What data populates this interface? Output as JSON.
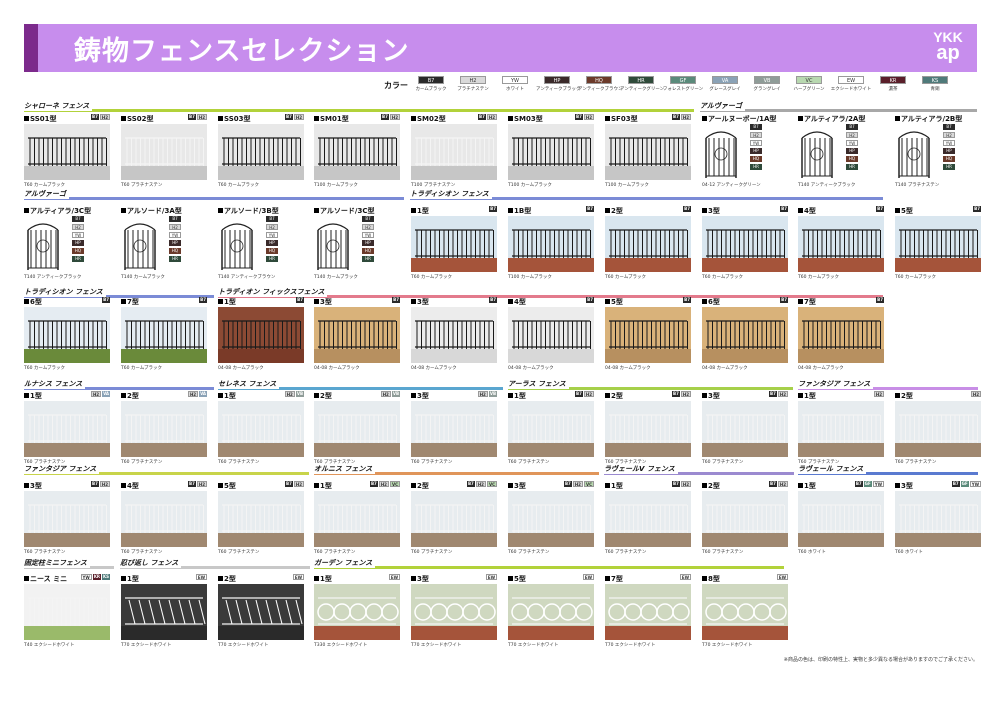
{
  "header": {
    "title": "鋳物フェンスセレクション",
    "logo_line1": "YKK",
    "logo_line2": "ap"
  },
  "colors": {
    "label": "カラー",
    "items": [
      {
        "code": "B7",
        "name": "カームブラック",
        "color": "#2a2a2a",
        "text": "#fff"
      },
      {
        "code": "H2",
        "name": "プラチナステン",
        "color": "#d9d9d9",
        "text": "#333"
      },
      {
        "code": "YW",
        "name": "ホワイト",
        "color": "#ffffff",
        "text": "#333"
      },
      {
        "code": "HP",
        "name": "アンティークブラック",
        "color": "#3a2a2a",
        "text": "#fff"
      },
      {
        "code": "HQ",
        "name": "アンティークブラウン",
        "color": "#6b3a2a",
        "text": "#fff"
      },
      {
        "code": "HR",
        "name": "アンティークグリーン",
        "color": "#2f4a3a",
        "text": "#fff"
      },
      {
        "code": "GF",
        "name": "フォレストグリーン",
        "color": "#5a8a7a",
        "text": "#fff"
      },
      {
        "code": "VA",
        "name": "グレースグレイ",
        "color": "#8aa2b6",
        "text": "#fff"
      },
      {
        "code": "VB",
        "name": "グラングレイ",
        "color": "#8f9c98",
        "text": "#fff"
      },
      {
        "code": "VC",
        "name": "ハーブグリーン",
        "color": "#b8d8b0",
        "text": "#333"
      },
      {
        "code": "EW",
        "name": "エクシードホワイト",
        "color": "#ffffff",
        "text": "#333"
      },
      {
        "code": "KR",
        "name": "濃茶",
        "color": "#5a1f2a",
        "text": "#fff"
      },
      {
        "code": "KS",
        "name": "青銅",
        "color": "#4f7a7a",
        "text": "#fff"
      }
    ]
  },
  "sections": [
    {
      "id": "s1",
      "title": "シャローネ フェンス",
      "stripe": "#b2d23a"
    },
    {
      "id": "s2",
      "title": "アルヴァーゴ",
      "stripe": "#a8a8a8"
    },
    {
      "id": "s3",
      "title": "アルヴァーゴ",
      "stripe": "#7b8bd6"
    },
    {
      "id": "s4",
      "title": "トラディシオン フェンス",
      "stripe": "#7b8bd6"
    },
    {
      "id": "s5",
      "title": "トラディシオン フェンス",
      "stripe": "#7b8bd6"
    },
    {
      "id": "s6",
      "title": "トラディオン フィックスフェンス",
      "stripe": "#e37a8c"
    },
    {
      "id": "s7",
      "title": "ルナシス フェンス",
      "stripe": "#7b8bd6"
    },
    {
      "id": "s8",
      "title": "セレネス フェンス",
      "stripe": "#5aa6d0"
    },
    {
      "id": "s9",
      "title": "アーラス フェンス",
      "stripe": "#a6d04a"
    },
    {
      "id": "s10",
      "title": "ファンタジア フェンス",
      "stripe": "#c88ee6"
    },
    {
      "id": "s11",
      "title": "ファンタジア フェンス",
      "stripe": "#c8d44a"
    },
    {
      "id": "s12",
      "title": "オルニス フェンス",
      "stripe": "#e0955a"
    },
    {
      "id": "s13",
      "title": "ラヴェールV フェンス",
      "stripe": "#9b8ad0"
    },
    {
      "id": "s14",
      "title": "ラヴェール フェンス",
      "stripe": "#5a7ad0"
    },
    {
      "id": "s15",
      "title": "固定柱ミニフェンス",
      "stripe": "#c8c8c8"
    },
    {
      "id": "s16",
      "title": "忍び返し フェンス",
      "stripe": "#c8c8c8"
    },
    {
      "id": "s17",
      "title": "ガーデン フェンス",
      "stripe": "#b2d23a"
    }
  ],
  "cards": [
    {
      "name": "SS01型",
      "badges": [
        "B7",
        "H2"
      ],
      "caption": "T60 カームブラック"
    },
    {
      "name": "SS02型",
      "badges": [
        "B7",
        "H2"
      ],
      "caption": "T60 プラチナステン"
    },
    {
      "name": "SS03型",
      "badges": [
        "B7",
        "H2"
      ],
      "caption": "T60 カームブラック"
    },
    {
      "name": "SM01型",
      "badges": [
        "B7",
        "H2"
      ],
      "caption": "T100 カームブラック"
    },
    {
      "name": "SM02型",
      "badges": [
        "B7",
        "H2"
      ],
      "caption": "T100 プラチナステン"
    },
    {
      "name": "SM03型",
      "badges": [
        "B7",
        "H2"
      ],
      "caption": "T100 カームブラック"
    },
    {
      "name": "SF03型",
      "badges": [
        "B7",
        "H2"
      ],
      "caption": "T100 カームブラック"
    },
    {
      "name": "アールヌーボー/1A型",
      "badges": [
        "B7",
        "H2",
        "YW",
        "HP",
        "HQ",
        "HR"
      ],
      "caption": "04-12 アンティークグリーン"
    },
    {
      "name": "アルティアラ/2A型",
      "badges": [
        "B7",
        "H2",
        "YW",
        "HP",
        "HQ",
        "HR"
      ],
      "caption": "T140 アンティークブラック"
    },
    {
      "name": "アルティアラ/2B型",
      "badges": [
        "B7",
        "H2",
        "YW",
        "HP",
        "HQ",
        "HR"
      ],
      "caption": "T140 プラチナステン"
    },
    {
      "name": "アルティアラ/3C型",
      "badges": [
        "B7",
        "H2",
        "YW",
        "HP",
        "HQ",
        "HR"
      ],
      "caption": "T140 アンティークブラック"
    },
    {
      "name": "アルソード/3A型",
      "badges": [
        "B7",
        "H2",
        "YW",
        "HP",
        "HQ",
        "HR"
      ],
      "caption": "T140 カームブラック"
    },
    {
      "name": "アルソード/3B型",
      "badges": [
        "B7",
        "H2",
        "YW",
        "HP",
        "HQ",
        "HR"
      ],
      "caption": "T140 アンティークブラウン"
    },
    {
      "name": "アルソード/3C型",
      "badges": [
        "B7",
        "H2",
        "YW",
        "HP",
        "HQ",
        "HR"
      ],
      "caption": "T140 カームブラック"
    },
    {
      "name": "1型",
      "badges": [
        "B7"
      ],
      "caption": "T60 カームブラック"
    },
    {
      "name": "1B型",
      "badges": [
        "B7"
      ],
      "caption": "T100 カームブラック"
    },
    {
      "name": "2型",
      "badges": [
        "B7"
      ],
      "caption": "T60 カームブラック"
    },
    {
      "name": "3型",
      "badges": [
        "B7"
      ],
      "caption": "T60 カームブラック"
    },
    {
      "name": "4型",
      "badges": [
        "B7"
      ],
      "caption": "T60 カームブラック"
    },
    {
      "name": "5型",
      "badges": [
        "B7"
      ],
      "caption": "T60 カームブラック"
    },
    {
      "name": "6型",
      "badges": [
        "B7"
      ],
      "caption": "T60 カームブラック"
    },
    {
      "name": "7型",
      "badges": [
        "B7"
      ],
      "caption": "T60 カームブラック"
    },
    {
      "name": "1型",
      "badges": [
        "B7"
      ],
      "caption": "04-08 カームブラック"
    },
    {
      "name": "3型",
      "badges": [
        "B7"
      ],
      "caption": "04-08 カームブラック"
    },
    {
      "name": "3型",
      "badges": [
        "B7"
      ],
      "caption": "04-08 カームブラック"
    },
    {
      "name": "4型",
      "badges": [
        "B7"
      ],
      "caption": "04-08 カームブラック"
    },
    {
      "name": "5型",
      "badges": [
        "B7"
      ],
      "caption": "04-08 カームブラック"
    },
    {
      "name": "6型",
      "badges": [
        "B7"
      ],
      "caption": "04-08 カームブラック"
    },
    {
      "name": "7型",
      "badges": [
        "B7"
      ],
      "caption": "04-08 カームブラック"
    },
    {
      "name": "1型",
      "badges": [
        "H2",
        "VA"
      ],
      "caption": "T60 プラチナステン"
    },
    {
      "name": "2型",
      "badges": [
        "H2",
        "VA"
      ],
      "caption": "T60 プラチナステン"
    },
    {
      "name": "1型",
      "badges": [
        "H2",
        "VB"
      ],
      "caption": "T60 プラチナステン"
    },
    {
      "name": "2型",
      "badges": [
        "H2",
        "VB"
      ],
      "caption": "T60 プラチナステン"
    },
    {
      "name": "3型",
      "badges": [
        "H2",
        "VB"
      ],
      "caption": "T60 プラチナステン"
    },
    {
      "name": "1型",
      "badges": [
        "B7",
        "H2"
      ],
      "caption": "T60 プラチナステン"
    },
    {
      "name": "2型",
      "badges": [
        "B7",
        "H2"
      ],
      "caption": "T60 プラチナステン"
    },
    {
      "name": "3型",
      "badges": [
        "B7",
        "H2"
      ],
      "caption": "T60 プラチナステン"
    },
    {
      "name": "1型",
      "badges": [
        "H2"
      ],
      "caption": "T60 プラチナステン"
    },
    {
      "name": "2型",
      "badges": [
        "H2"
      ],
      "caption": "T60 プラチナステン"
    },
    {
      "name": "3型",
      "badges": [
        "B7",
        "H2"
      ],
      "caption": "T60 プラチナステン"
    },
    {
      "name": "4型",
      "badges": [
        "B7",
        "H2"
      ],
      "caption": "T60 プラチナステン"
    },
    {
      "name": "5型",
      "badges": [
        "B7",
        "H2"
      ],
      "caption": "T60 プラチナステン"
    },
    {
      "name": "1型",
      "badges": [
        "B7",
        "H2",
        "VC"
      ],
      "caption": "T60 プラチナステン"
    },
    {
      "name": "2型",
      "badges": [
        "B7",
        "H2",
        "VC"
      ],
      "caption": "T60 プラチナステン"
    },
    {
      "name": "3型",
      "badges": [
        "B7",
        "H2",
        "VC"
      ],
      "caption": "T60 プラチナステン"
    },
    {
      "name": "1型",
      "badges": [
        "B7",
        "H2"
      ],
      "caption": "T60 プラチナステン"
    },
    {
      "name": "2型",
      "badges": [
        "B7",
        "H2"
      ],
      "caption": "T60 プラチナステン"
    },
    {
      "name": "1型",
      "badges": [
        "B7",
        "GF",
        "YW"
      ],
      "caption": "T60 ホワイト"
    },
    {
      "name": "3型",
      "badges": [
        "B7",
        "GF",
        "YW"
      ],
      "caption": "T60 ホワイト"
    },
    {
      "name": "ニース ミニ",
      "badges": [
        "YW",
        "KR",
        "KS"
      ],
      "caption": "T40 エクシードホワイト"
    },
    {
      "name": "1型",
      "badges": [
        "EW"
      ],
      "caption": "T70 エクシードホワイト"
    },
    {
      "name": "2型",
      "badges": [
        "EW"
      ],
      "caption": "T70 エクシードホワイト"
    },
    {
      "name": "1型",
      "badges": [
        "EW"
      ],
      "caption": "T330 エクシードホワイト"
    },
    {
      "name": "3型",
      "badges": [
        "EW"
      ],
      "caption": "T70 エクシードホワイト"
    },
    {
      "name": "5型",
      "badges": [
        "EW"
      ],
      "caption": "T70 エクシードホワイト"
    },
    {
      "name": "7型",
      "badges": [
        "EW"
      ],
      "caption": "T70 エクシードホワイト"
    },
    {
      "name": "8型",
      "badges": [
        "EW"
      ],
      "caption": "T70 エクシードホワイト"
    }
  ],
  "note": "※商品の色は、印刷の特性上、実物と多少異なる場合がありますのでご了承ください。"
}
